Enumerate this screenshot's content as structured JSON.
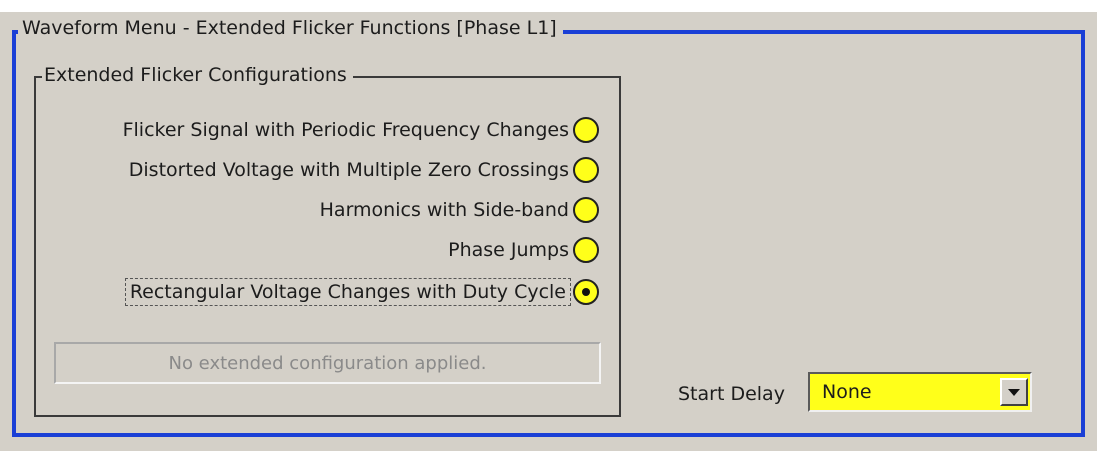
{
  "window": {
    "title": "Waveform Menu - Extended Flicker Functions [Phase L1]"
  },
  "group": {
    "title": "Extended Flicker Configurations",
    "options": [
      {
        "label": "Flicker Signal with Periodic Frequency Changes",
        "selected": false
      },
      {
        "label": "Distorted Voltage with Multiple Zero Crossings",
        "selected": false
      },
      {
        "label": "Harmonics with Side-band",
        "selected": false
      },
      {
        "label": "Phase Jumps",
        "selected": false
      },
      {
        "label": "Rectangular Voltage Changes with Duty Cycle",
        "selected": true
      }
    ],
    "status": "No extended configuration applied."
  },
  "start_delay": {
    "label": "Start Delay",
    "value": "None"
  },
  "colors": {
    "frame_border": "#1a3fd6",
    "radio_fill": "#ffff1a",
    "background": "#d4d0c8"
  }
}
